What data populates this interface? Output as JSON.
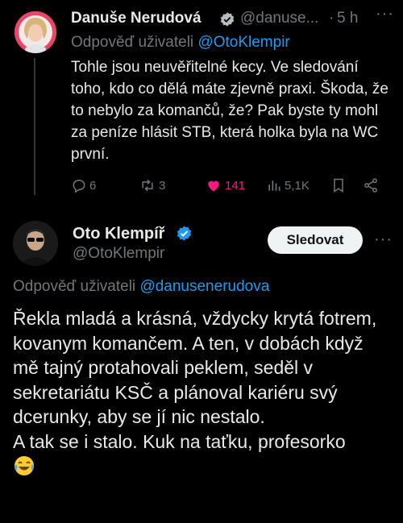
{
  "tweet1": {
    "author_name": "Danuše Nerudová",
    "author_handle": "@danuse...",
    "time_sep": "·",
    "time": "5 h",
    "reply_prefix": "Odpověď uživateli",
    "reply_to": "@OtoKlempir",
    "text": "Tohle jsou neuvěřitelné kecy. Ve sledování toho, kdo co dělá máte zjevně praxi. Škoda, že to nebylo za komančů, že? Pak byste ty mohl za peníze hlásit STB, která holka byla na WC první.",
    "stats": {
      "replies": "6",
      "retweets": "3",
      "likes": "141",
      "views": "5,1K"
    },
    "more_label": "···",
    "verified_icon": "verified-badge-icon"
  },
  "tweet2": {
    "author_name": "Oto Klempíř",
    "author_handle": "@OtoKlempir",
    "follow_label": "Sledovat",
    "more_label": "···",
    "reply_prefix": "Odpověď uživateli",
    "reply_to": "@danusenerudova",
    "text": "Řekla mladá a krásná, vždycky krytá fotrem, kovanym komančem. A ten, v dobách když mě tajný protahovali peklem, seděl v sekretariátu KSČ a plánoval kariéru svý dcerunky, aby se jí nic nestalo.\nA tak se i stalo. Kuk na taťku, profesorko",
    "emoji": "face-with-tears-of-joy"
  },
  "colors": {
    "background": "#000000",
    "text": "#e7e9ea",
    "secondary": "#71767b",
    "accent": "#1d9bf0",
    "like": "#f91880"
  }
}
